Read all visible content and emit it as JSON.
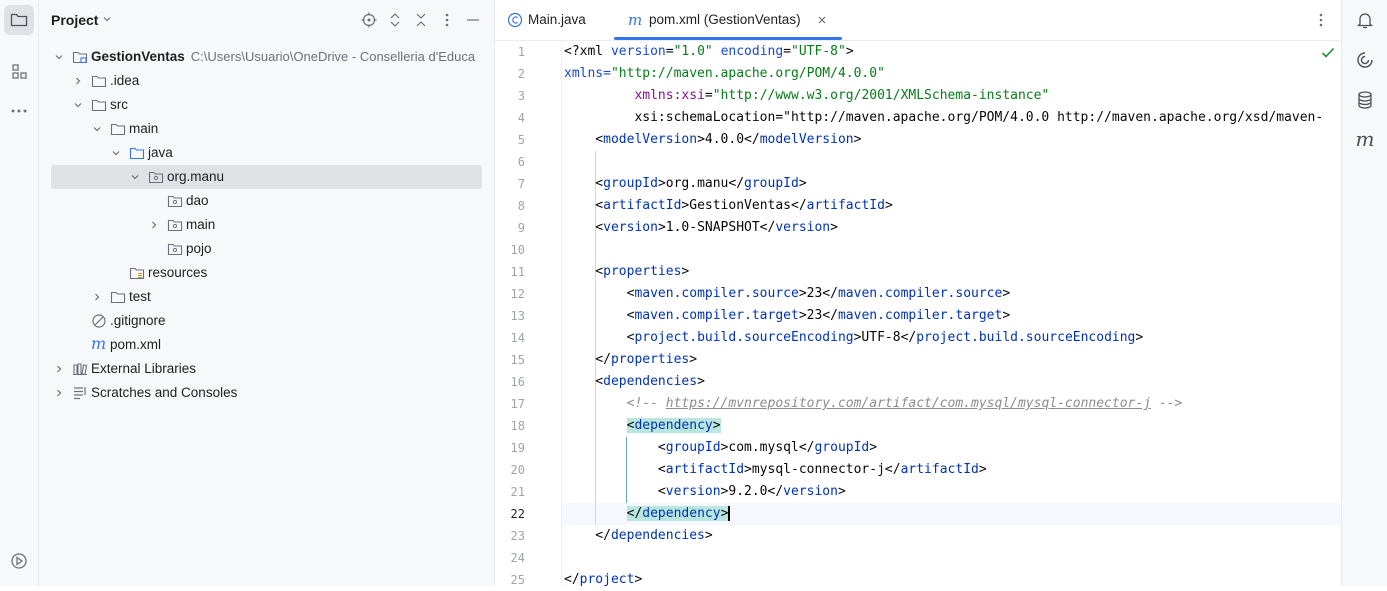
{
  "project_panel": {
    "title": "Project",
    "tree": [
      {
        "label": "GestionVentas",
        "path": "C:\\Users\\Usuario\\OneDrive - Conselleria d'Educa",
        "icon": "module-folder-icon",
        "chevron": "down",
        "indent": 0
      },
      {
        "label": ".idea",
        "icon": "folder-icon",
        "chevron": "right",
        "indent": 1
      },
      {
        "label": "src",
        "icon": "folder-icon",
        "chevron": "down",
        "indent": 1
      },
      {
        "label": "main",
        "icon": "folder-icon",
        "chevron": "down",
        "indent": 2
      },
      {
        "label": "java",
        "icon": "source-folder-icon",
        "chevron": "down",
        "indent": 3
      },
      {
        "label": "org.manu",
        "icon": "package-icon",
        "chevron": "down",
        "indent": 4,
        "selected": true
      },
      {
        "label": "dao",
        "icon": "package-icon",
        "chevron": "none",
        "indent": 5
      },
      {
        "label": "main",
        "icon": "package-icon",
        "chevron": "right",
        "indent": 5
      },
      {
        "label": "pojo",
        "icon": "package-icon",
        "chevron": "none",
        "indent": 5
      },
      {
        "label": "resources",
        "icon": "resources-folder-icon",
        "chevron": "none",
        "indent": 3
      },
      {
        "label": "test",
        "icon": "folder-icon",
        "chevron": "right",
        "indent": 2
      },
      {
        "label": ".gitignore",
        "icon": "ignored-file-icon",
        "chevron": "none",
        "indent": 1
      },
      {
        "label": "pom.xml",
        "icon": "maven-icon",
        "chevron": "none",
        "indent": 1
      },
      {
        "label": "External Libraries",
        "icon": "libraries-icon",
        "chevron": "right",
        "indent": 0
      },
      {
        "label": "Scratches and Consoles",
        "icon": "scratches-icon",
        "chevron": "right",
        "indent": 0
      }
    ]
  },
  "tabs": [
    {
      "label": "Main.java",
      "icon": "java-class-icon",
      "active": false
    },
    {
      "label": "pom.xml (GestionVentas)",
      "icon": "maven-icon",
      "active": true
    }
  ],
  "editor": {
    "current_line": 22,
    "line_numbers": [
      "1",
      "2",
      "3",
      "4",
      "5",
      "6",
      "7",
      "8",
      "9",
      "10",
      "11",
      "12",
      "13",
      "14",
      "15",
      "16",
      "17",
      "18",
      "19",
      "20",
      "21",
      "22",
      "23",
      "24",
      "25"
    ],
    "lines": [
      "<?xml version=\"1.0\" encoding=\"UTF-8\"?>",
      "<project xmlns=\"http://maven.apache.org/POM/4.0.0\"",
      "         xmlns:xsi=\"http://www.w3.org/2001/XMLSchema-instance\"",
      "         xsi:schemaLocation=\"http://maven.apache.org/POM/4.0.0 http://maven.apache.org/xsd/maven-",
      "    <modelVersion>4.0.0</modelVersion>",
      "",
      "    <groupId>org.manu</groupId>",
      "    <artifactId>GestionVentas</artifactId>",
      "    <version>1.0-SNAPSHOT</version>",
      "",
      "    <properties>",
      "        <maven.compiler.source>23</maven.compiler.source>",
      "        <maven.compiler.target>23</maven.compiler.target>",
      "        <project.build.sourceEncoding>UTF-8</project.build.sourceEncoding>",
      "    </properties>",
      "    <dependencies>",
      "        <!-- https://mvnrepository.com/artifact/com.mysql/mysql-connector-j -->",
      "        <dependency>",
      "            <groupId>com.mysql</groupId>",
      "            <artifactId>mysql-connector-j</artifactId>",
      "            <version>9.2.0</version>",
      "        </dependency>",
      "    </dependencies>",
      "",
      "</project>"
    ]
  },
  "icons": {
    "left_strip": [
      "project-folder-icon",
      "structure-icon",
      "more-icon",
      "run-icon"
    ],
    "right_strip": [
      "notifications-icon",
      "ai-assistant-icon",
      "database-icon",
      "maven-tool-icon"
    ],
    "header": [
      "locate-icon",
      "expand-icon",
      "collapse-icon",
      "options-icon",
      "hide-icon"
    ]
  },
  "colors": {
    "accent": "#3574f0",
    "tag": "#0033b3",
    "attr": "#174ad4",
    "string": "#067d17",
    "comment": "#8c8c8c",
    "match_highlight": "#b9e7e0",
    "check": "#208a3c"
  }
}
